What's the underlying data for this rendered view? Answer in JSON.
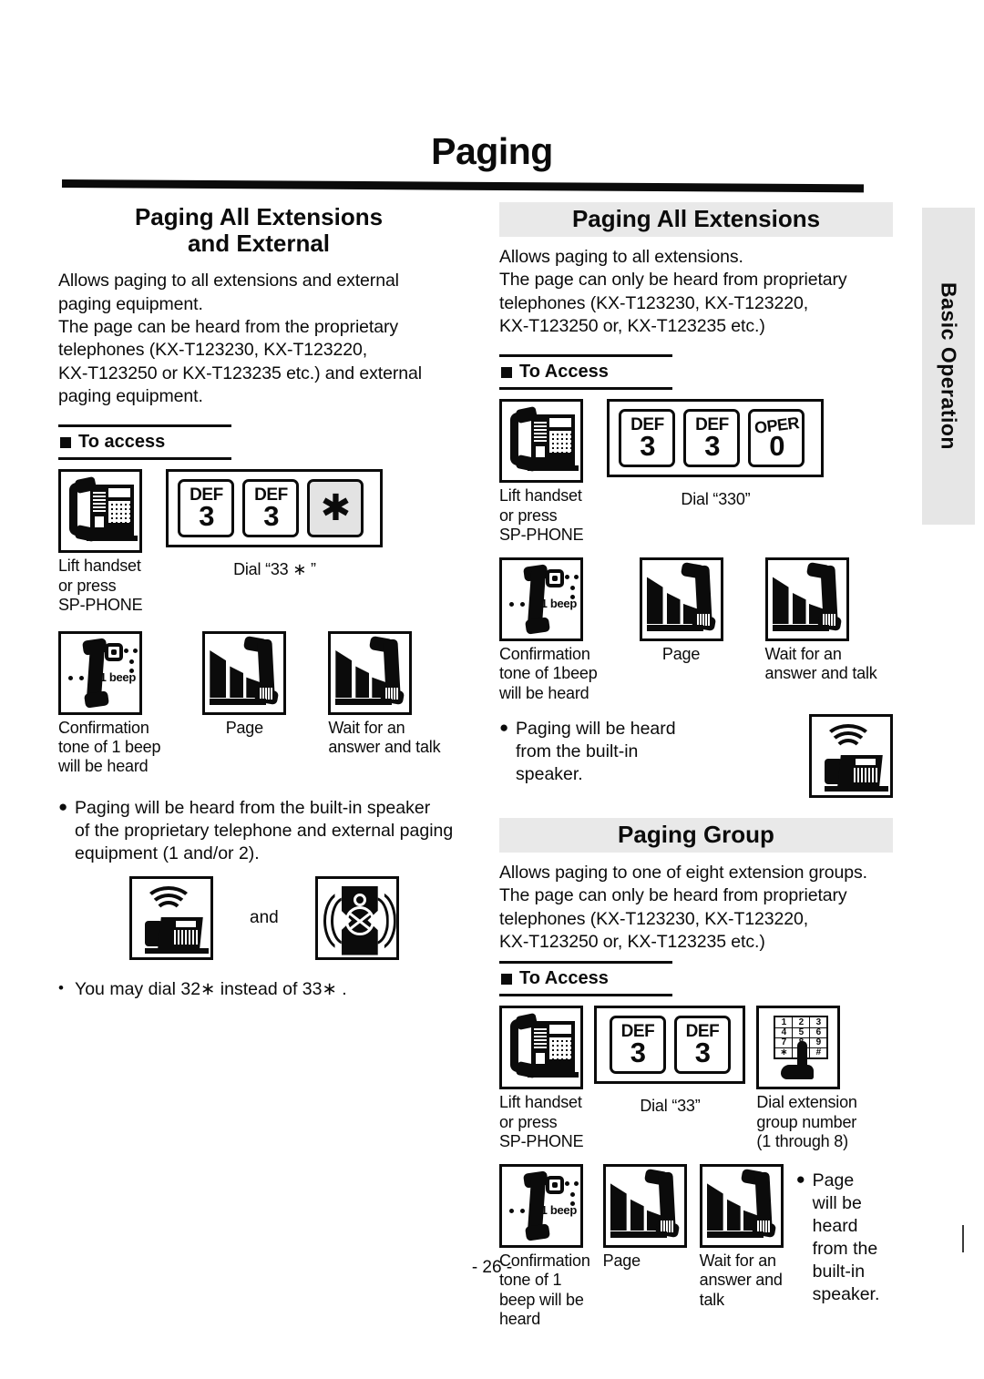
{
  "document": {
    "title": "Paging",
    "page_number": "- 26 -",
    "index_tab": "Basic Operation"
  },
  "sections": [
    {
      "id": "paging-all-extensions-and-external",
      "heading_line1": "Paging All Extensions",
      "heading_line2": "and External",
      "body": [
        "Allows paging to all extensions and external",
        "paging equipment.",
        "The page can be heard from the proprietary",
        "telephones (KX-T123230, KX-T123220,",
        "KX-T123250 or KX-T123235 etc.) and external",
        "paging equipment."
      ],
      "access_label": "To access",
      "steps_row1": [
        {
          "icon": "telephone-handset-lift",
          "caption": [
            "Lift handset",
            "or press",
            "SP-PHONE"
          ]
        },
        {
          "icon": "dial-keys",
          "keys": [
            {
              "letters": "DEF",
              "digit": "3"
            },
            {
              "letters": "DEF",
              "digit": "3"
            },
            {
              "letters": "",
              "digit": "✱",
              "style": "star"
            }
          ],
          "caption": [
            "Dial “33 ∗ ”"
          ]
        }
      ],
      "steps_row2": [
        {
          "icon": "confirmation-beep",
          "beep_label": "1 beep",
          "caption": [
            "Confirmation",
            "tone of 1 beep",
            "will be heard"
          ]
        },
        {
          "icon": "page-announce",
          "caption": [
            "Page"
          ]
        },
        {
          "icon": "wait-answer-talk",
          "caption": [
            "Wait for an",
            "answer and talk"
          ]
        }
      ],
      "notes": [
        {
          "lines": [
            "Paging will be heard from the built-in speaker",
            "of the proprietary telephone and external paging",
            "equipment (1 and/or 2)."
          ]
        }
      ],
      "note_icons": {
        "left": "built-in-speaker-phone",
        "joiner": "and",
        "right": "external-horn-speaker"
      },
      "notes_tail": [
        {
          "lines": [
            "You may dial 32∗  instead of 33∗ ."
          ]
        }
      ]
    },
    {
      "id": "paging-all-extensions",
      "heading_line1": "Paging All Extensions",
      "body": [
        "Allows paging to all extensions.",
        "The page can only be heard from proprietary",
        "telephones (KX-T123230, KX-T123220,",
        "KX-T123250 or, KX-T123235 etc.)"
      ],
      "access_label": "To Access",
      "steps_row1": [
        {
          "icon": "telephone-handset-lift",
          "caption": [
            "Lift handset",
            "or press",
            "SP-PHONE"
          ]
        },
        {
          "icon": "dial-keys",
          "keys": [
            {
              "letters": "DEF",
              "digit": "3"
            },
            {
              "letters": "DEF",
              "digit": "3"
            },
            {
              "letters": "OPER",
              "digit": "0",
              "style": "oper"
            }
          ],
          "caption": [
            "Dial “330”"
          ]
        }
      ],
      "steps_row2": [
        {
          "icon": "confirmation-beep",
          "beep_label": "1 beep",
          "caption": [
            "Confirmation",
            "tone of 1beep",
            "will be heard"
          ]
        },
        {
          "icon": "page-announce",
          "caption": [
            "Page"
          ]
        },
        {
          "icon": "wait-answer-talk",
          "caption": [
            "Wait for an",
            "answer and talk"
          ]
        }
      ],
      "notes": [
        {
          "lines": [
            "Paging will be heard",
            "from the built-in",
            "speaker."
          ]
        }
      ],
      "note_icon": "built-in-speaker-phone"
    },
    {
      "id": "paging-group",
      "heading_line1": "Paging Group",
      "body": [
        "Allows paging to one of eight extension groups.",
        "The page can only be heard from proprietary",
        "telephones (KX-T123230, KX-T123220,",
        "KX-T123250 or, KX-T123235 etc.)"
      ],
      "access_label": "To Access",
      "steps_row1": [
        {
          "icon": "telephone-handset-lift",
          "caption": [
            "Lift handset",
            "or press",
            "SP-PHONE"
          ]
        },
        {
          "icon": "dial-keys",
          "keys": [
            {
              "letters": "DEF",
              "digit": "3"
            },
            {
              "letters": "DEF",
              "digit": "3"
            }
          ],
          "caption": [
            "Dial “33”"
          ]
        },
        {
          "icon": "keypad-finger",
          "keypad": [
            "1",
            "2",
            "3",
            "4",
            "5",
            "6",
            "7",
            "8",
            "9",
            "∗",
            "0",
            "#"
          ],
          "caption": [
            "Dial extension",
            "group number",
            "(1 through 8)"
          ]
        }
      ],
      "steps_row2": [
        {
          "icon": "confirmation-beep",
          "beep_label": "1 beep",
          "caption": [
            "Confirmation",
            "tone of 1",
            "beep will be",
            "heard"
          ]
        },
        {
          "icon": "page-announce",
          "caption": [
            "Page"
          ]
        },
        {
          "icon": "wait-answer-talk",
          "caption": [
            "Wait for an",
            "answer and",
            "talk"
          ]
        }
      ],
      "notes": [
        {
          "lines": [
            "Page",
            "will be",
            "heard",
            "from the",
            "built-in",
            "speaker."
          ]
        }
      ]
    }
  ],
  "colors": {
    "ink": "#0b0b0b",
    "paper": "#ffffff",
    "shade": "#e9e9e9",
    "tab": "#e6e6e6"
  }
}
